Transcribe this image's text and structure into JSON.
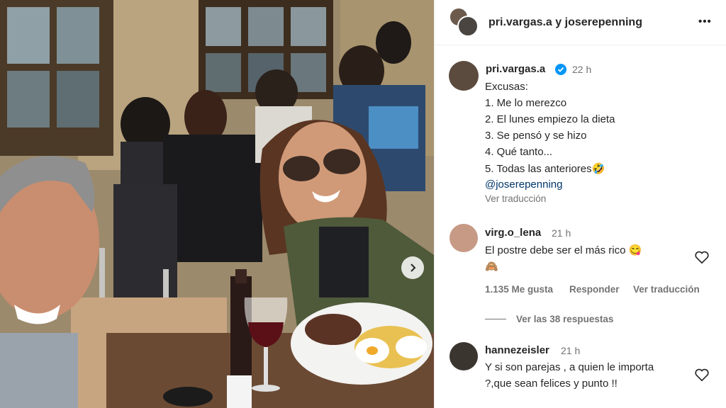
{
  "header": {
    "title": "pri.vargas.a y joserepenning",
    "more_label": "•••"
  },
  "post": {
    "author": "pri.vargas.a",
    "time": "22 h",
    "caption_lines": [
      "Excusas:",
      "1. Me lo merezco",
      "2. El lunes empiezo la dieta",
      "3. Se pensó y se hizo",
      "4. Qué tanto...",
      "5. Todas las anteriores🤣"
    ],
    "mention": "@joserepenning",
    "translate": "Ver traducción"
  },
  "comments": [
    {
      "user": "virg.o_lena",
      "time": "21 h",
      "text_line1": "El postre debe ser el más rico 😋",
      "text_line2": "🙈",
      "likes": "1.135 Me gusta",
      "reply": "Responder",
      "translate": "Ver traducción",
      "view_replies": "Ver las 38 respuestas"
    },
    {
      "user": "hannezeisler",
      "time": "21 h",
      "text_line1": "Y si son parejas , a quien le importa",
      "text_line2": "?,que sean felices y punto !!"
    }
  ],
  "colors": {
    "accent_link": "#00376b",
    "verified": "#0095f6",
    "muted": "#737373"
  }
}
